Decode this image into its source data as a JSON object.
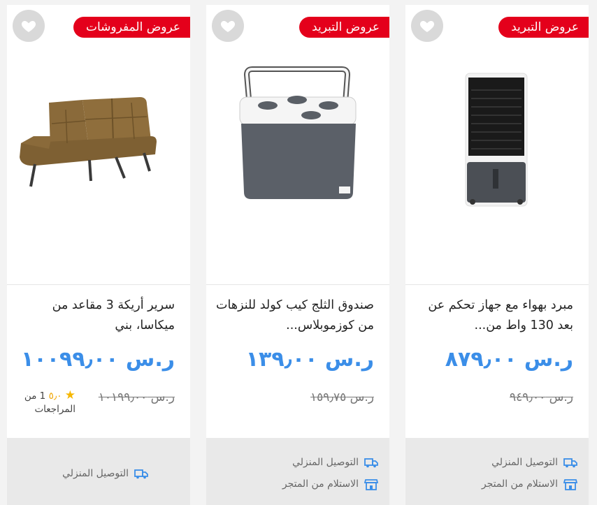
{
  "colors": {
    "badge": "#e4001b",
    "price": "#3b8ee8",
    "icon": "#3b8ee8"
  },
  "cards": [
    {
      "badge": "عروض التبريد",
      "title": "مبرد بهواء مع جهاز تحكم عن بعد 130 واط من...",
      "price": "ر.س   ٨٧٩٫٠٠",
      "old_price": "ر.س ٩٤٩٫٠٠",
      "delivery_home": "التوصيل المنزلي",
      "store_pickup": "الاستلام من المتجر",
      "image": "air-cooler"
    },
    {
      "badge": "عروض التبريد",
      "title": "صندوق الثلج كيب كولد للنزهات من كوزموبلاس...",
      "price": "ر.س   ١٣٩٫٠٠",
      "old_price": "ر.س ١٥٩٫٧٥",
      "delivery_home": "التوصيل المنزلي",
      "store_pickup": "الاستلام من المتجر",
      "image": "ice-cooler-box"
    },
    {
      "badge": "عروض المفروشات",
      "title": "سرير أريكة 3 مقاعد من ميكاسا، بني",
      "price": "ر.س   ١٠٠٩٩٫٠٠",
      "old_price": "ر.س ١٠١٩٩٫٠٠",
      "rating_value": "٥٫٠",
      "rating_count": "1 من المراجعات",
      "delivery_home": "التوصيل المنزلي",
      "image": "sofa-bed"
    }
  ]
}
